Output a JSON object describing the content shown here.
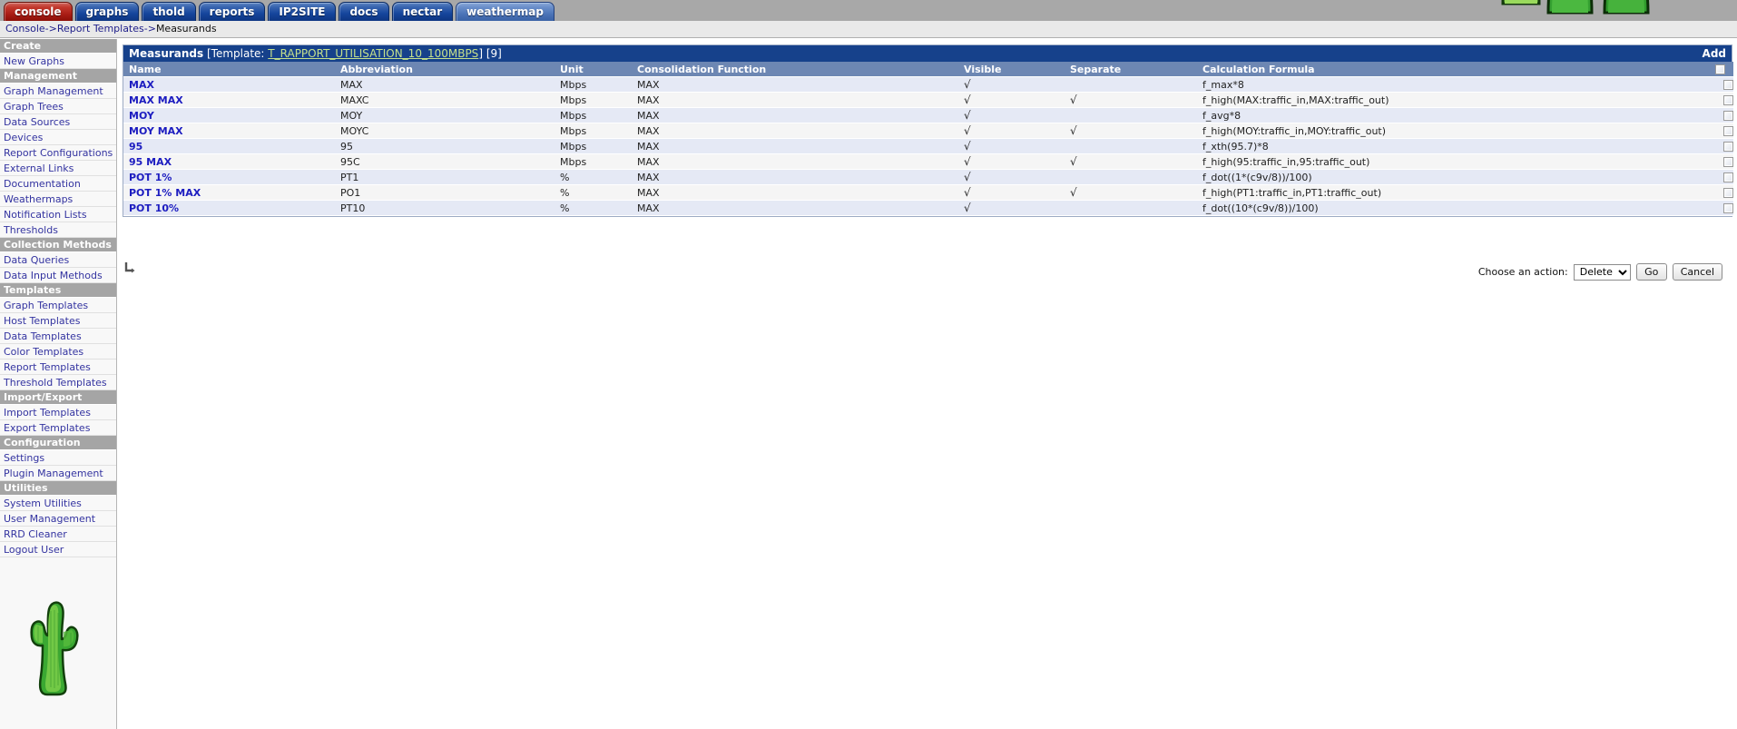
{
  "tabs": [
    {
      "label": "console",
      "style": "red"
    },
    {
      "label": "graphs",
      "style": "blue"
    },
    {
      "label": "thold",
      "style": "blue"
    },
    {
      "label": "reports",
      "style": "blue"
    },
    {
      "label": "IP2SITE",
      "style": "blue"
    },
    {
      "label": "docs",
      "style": "blue"
    },
    {
      "label": "nectar",
      "style": "blue"
    },
    {
      "label": "weathermap",
      "style": "light"
    }
  ],
  "breadcrumb": {
    "item1": "Console",
    "sep1": "->",
    "item2": "Report Templates",
    "sep2": "->",
    "item3": "Measurands"
  },
  "sidebar": {
    "groups": [
      {
        "header": "Create",
        "items": [
          "New Graphs"
        ]
      },
      {
        "header": "Management",
        "items": [
          "Graph Management",
          "Graph Trees",
          "Data Sources",
          "Devices",
          "Report Configurations",
          "External Links",
          "Documentation",
          "Weathermaps",
          "Notification Lists",
          "Thresholds"
        ]
      },
      {
        "header": "Collection Methods",
        "items": [
          "Data Queries",
          "Data Input Methods"
        ]
      },
      {
        "header": "Templates",
        "items": [
          "Graph Templates",
          "Host Templates",
          "Data Templates",
          "Color Templates",
          "Report Templates",
          "Threshold Templates"
        ]
      },
      {
        "header": "Import/Export",
        "items": [
          "Import Templates",
          "Export Templates"
        ]
      },
      {
        "header": "Configuration",
        "items": [
          "Settings",
          "Plugin Management"
        ]
      },
      {
        "header": "Utilities",
        "items": [
          "System Utilities",
          "User Management",
          "RRD Cleaner",
          "Logout User"
        ]
      }
    ],
    "logo": "cactus-logo"
  },
  "panel": {
    "title": "Measurands",
    "template_prefix": "[Template:",
    "template_name": "T_RAPPORT_UTILISATION_10_100MBPS",
    "template_suffix": "]",
    "count": "[9]",
    "add_label": "Add"
  },
  "table": {
    "columns": [
      "Name",
      "Abbreviation",
      "Unit",
      "Consolidation Function",
      "Visible",
      "Separate",
      "Calculation Formula"
    ],
    "check_glyph": "√",
    "rows": [
      {
        "name": "MAX",
        "abbreviation": "MAX",
        "unit": "Mbps",
        "consolidation": "MAX",
        "visible": true,
        "separate": false,
        "formula": "f_max*8"
      },
      {
        "name": "MAX MAX",
        "abbreviation": "MAXC",
        "unit": "Mbps",
        "consolidation": "MAX",
        "visible": true,
        "separate": true,
        "formula": "f_high(MAX:traffic_in,MAX:traffic_out)"
      },
      {
        "name": "MOY",
        "abbreviation": "MOY",
        "unit": "Mbps",
        "consolidation": "MAX",
        "visible": true,
        "separate": false,
        "formula": "f_avg*8"
      },
      {
        "name": "MOY MAX",
        "abbreviation": "MOYC",
        "unit": "Mbps",
        "consolidation": "MAX",
        "visible": true,
        "separate": true,
        "formula": "f_high(MOY:traffic_in,MOY:traffic_out)"
      },
      {
        "name": "95",
        "abbreviation": "95",
        "unit": "Mbps",
        "consolidation": "MAX",
        "visible": true,
        "separate": false,
        "formula": "f_xth(95.7)*8"
      },
      {
        "name": "95 MAX",
        "abbreviation": "95C",
        "unit": "Mbps",
        "consolidation": "MAX",
        "visible": true,
        "separate": true,
        "formula": "f_high(95:traffic_in,95:traffic_out)"
      },
      {
        "name": "POT 1%",
        "abbreviation": "PT1",
        "unit": "%",
        "consolidation": "MAX",
        "visible": true,
        "separate": false,
        "formula": "f_dot((1*(c9v/8))/100)"
      },
      {
        "name": "POT 1% MAX",
        "abbreviation": "PO1",
        "unit": "%",
        "consolidation": "MAX",
        "visible": true,
        "separate": true,
        "formula": "f_high(PT1:traffic_in,PT1:traffic_out)"
      },
      {
        "name": "POT 10%",
        "abbreviation": "PT10",
        "unit": "%",
        "consolidation": "MAX",
        "visible": true,
        "separate": false,
        "formula": "f_dot((10*(c9v/8))/100)"
      }
    ]
  },
  "footer": {
    "action_label": "Choose an action:",
    "action_selected": "Delete",
    "action_options": [
      "Delete"
    ],
    "go_label": "Go",
    "cancel_label": "Cancel",
    "subtree_icon": "return-arrow-icon"
  },
  "colors": {
    "tab_blue": "#15459c",
    "tab_red": "#a81c14",
    "title_bar": "#16418b",
    "table_header": "#6d87b3",
    "row_odd": "#e5e9f5",
    "row_even": "#f5f5f5",
    "link": "#1c1cc0",
    "template_green": "#c5e08b",
    "top_bar_gray": "#a8a8a8"
  }
}
